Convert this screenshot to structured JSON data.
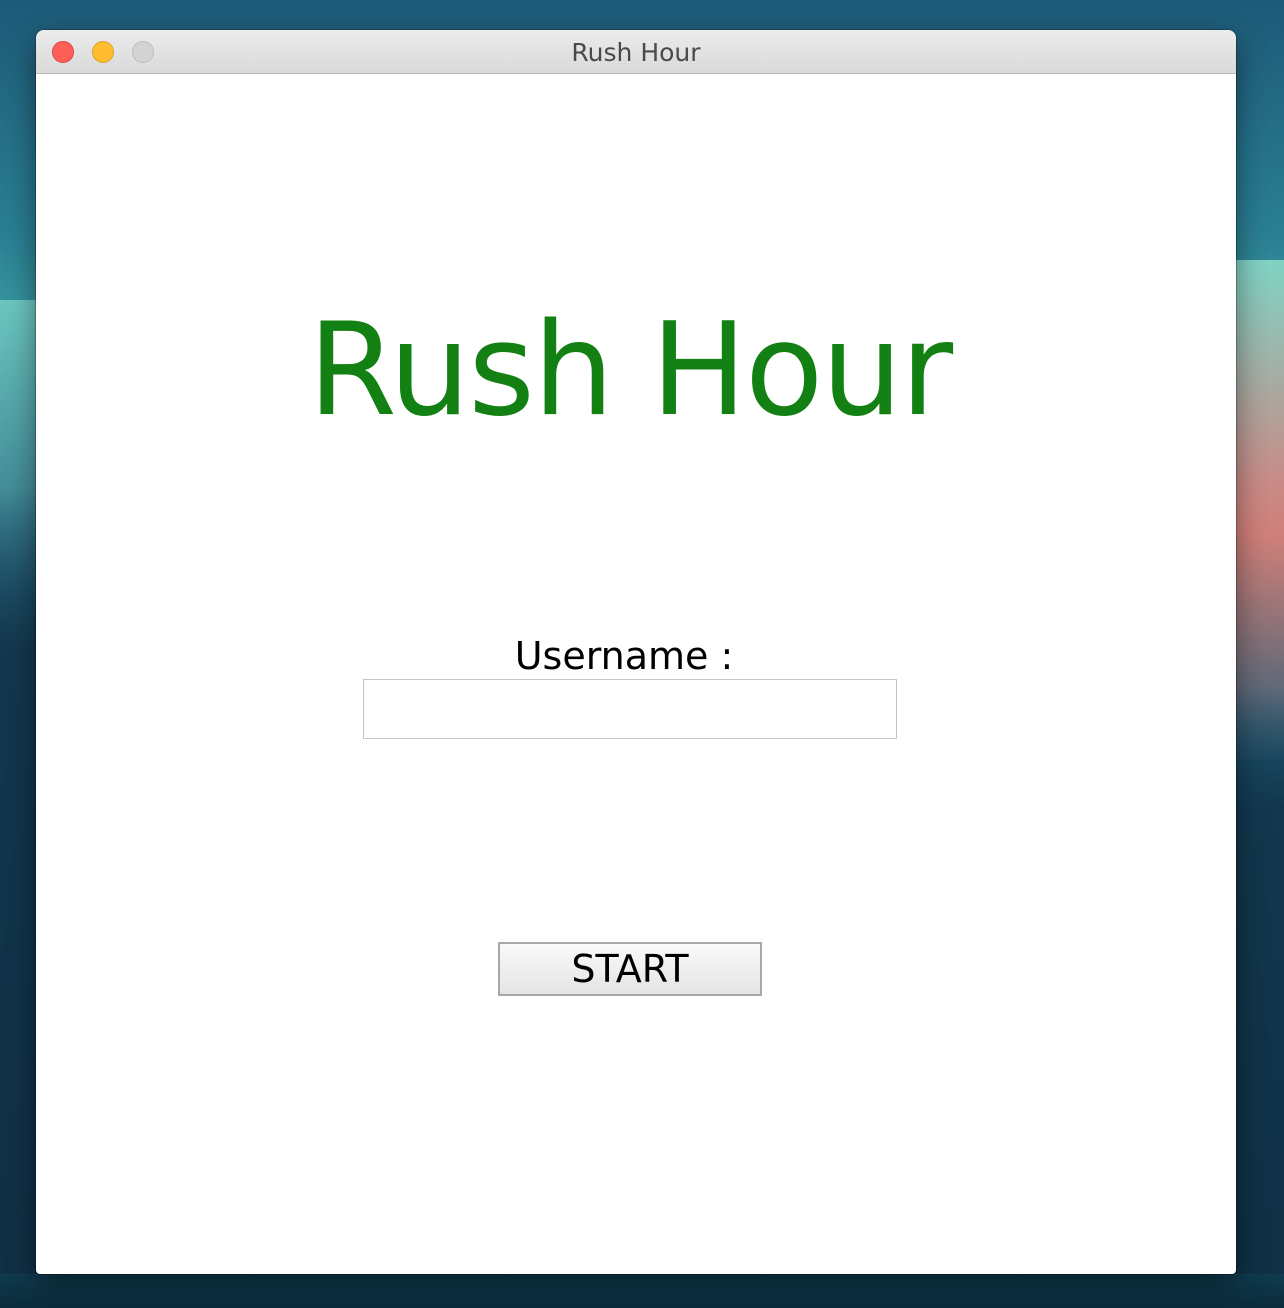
{
  "window": {
    "title": "Rush Hour"
  },
  "main": {
    "title": "Rush Hour",
    "username_label": "Username :",
    "username_value": "",
    "start_label": "START"
  },
  "colors": {
    "title_green": "#128012",
    "close": "#fe5f57",
    "minimize": "#febc2e",
    "maximize_disabled": "#d3d3d3"
  }
}
